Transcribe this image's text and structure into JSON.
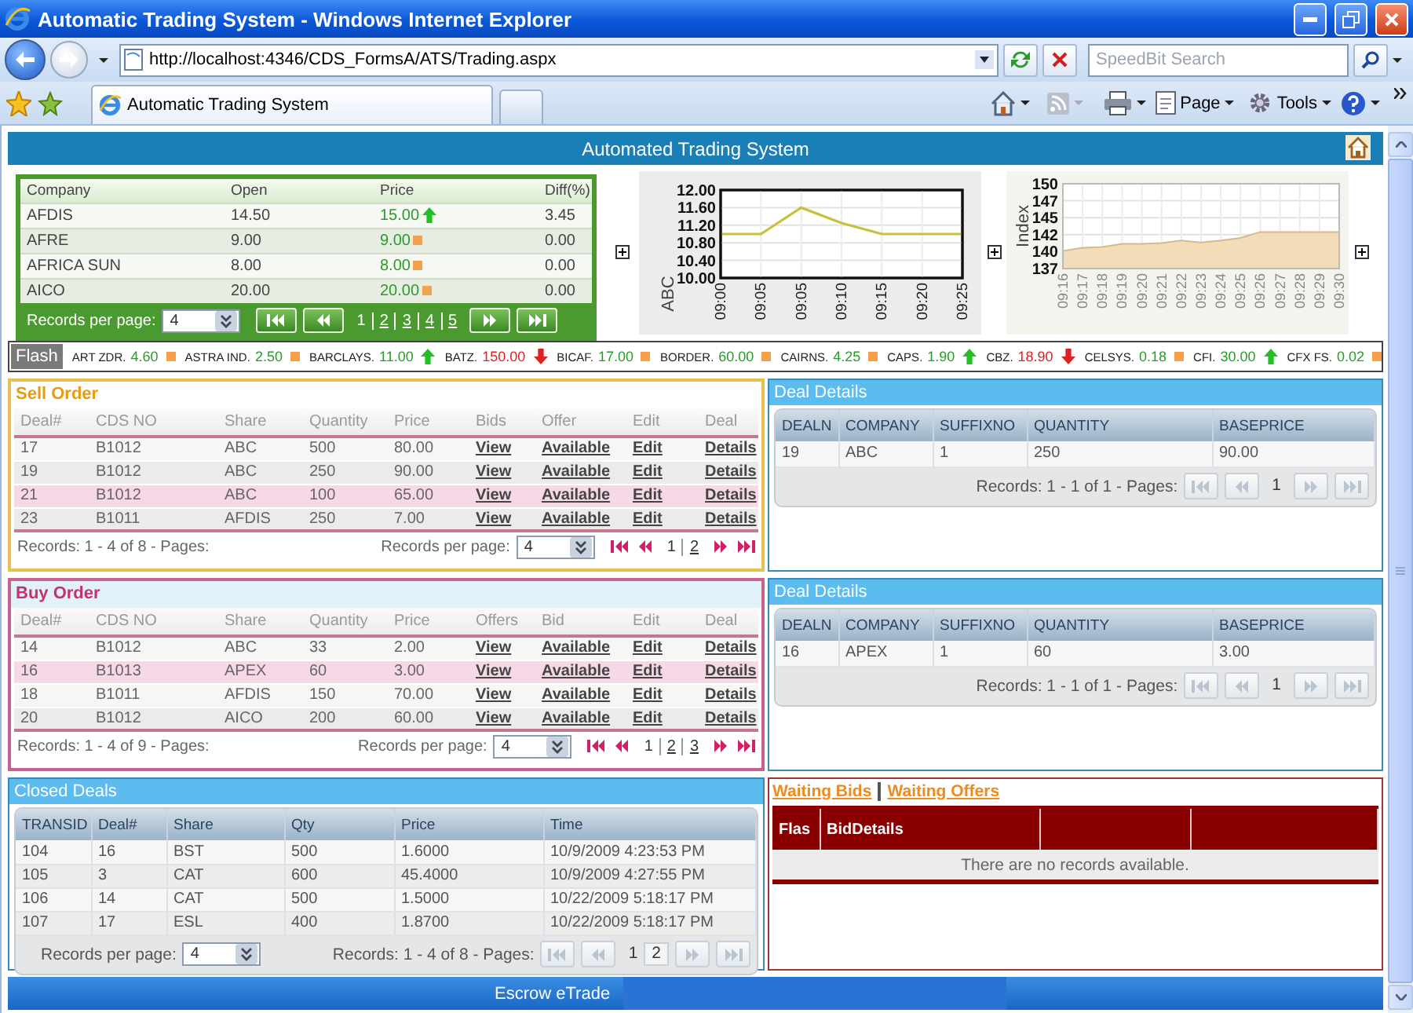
{
  "browser": {
    "title": "Automatic Trading System - Windows Internet Explorer",
    "address": "http://localhost:4346/CDS_FormsA/ATS/Trading.aspx",
    "search_placeholder": "SpeedBit Search",
    "tab": "Automatic Trading System",
    "menus": [
      "Page",
      "Tools"
    ]
  },
  "header": {
    "title": "Automated Trading System"
  },
  "market": {
    "columns": [
      {
        "label": "Company",
        "kind": "text"
      },
      {
        "label": "Open",
        "kind": "text"
      },
      {
        "label": "Price",
        "kind": "trend"
      },
      {
        "label": "Diff(%)",
        "kind": "text"
      }
    ],
    "rows": [
      {
        "cells": [
          "AFDIS",
          "14.50",
          "15.00",
          "3.45"
        ],
        "kind": "up"
      },
      {
        "cells": [
          "AFRE",
          "9.00",
          "9.00",
          "0.00"
        ],
        "kind": "flat"
      },
      {
        "cells": [
          "AFRICA SUN",
          "8.00",
          "8.00",
          "0.00"
        ],
        "kind": "flat"
      },
      {
        "cells": [
          "AICO",
          "20.00",
          "20.00",
          "0.00"
        ],
        "kind": "flat"
      }
    ],
    "pager": {
      "size_label": "Records per page:",
      "page_size": "4",
      "pages": [
        {
          "label": "1",
          "selected": true
        },
        {
          "label": "2",
          "selected": false
        },
        {
          "label": "3",
          "selected": false
        },
        {
          "label": "4",
          "selected": false
        },
        {
          "label": "5",
          "selected": false
        }
      ]
    }
  },
  "charts": [
    {
      "chart_data": {
        "type": "line",
        "ylabel": "ABC",
        "categories": [
          "09:00",
          "09:05",
          "09:05",
          "09:10",
          "09:15",
          "09:20",
          "09:25"
        ],
        "grid": true,
        "series": [
          {
            "color": "#c8c03c",
            "values": [
              11.0,
              11.0,
              11.6,
              11.25,
              11.0,
              11.0,
              11.0
            ]
          }
        ],
        "ylim": [
          10,
          12
        ],
        "yticks": [
          {
            "value": 10,
            "label": "10.00"
          },
          {
            "value": 10.4,
            "label": "10.40"
          },
          {
            "value": 10.8,
            "label": "10.80"
          },
          {
            "value": 11.2,
            "label": "11.20"
          },
          {
            "value": 11.6,
            "label": "11.60"
          },
          {
            "value": 12,
            "label": "12.00"
          }
        ]
      }
    },
    {
      "chart_data": {
        "type": "area",
        "ylabel": "Index",
        "categories": [
          "09:16",
          "09:17",
          "09:18",
          "09:19",
          "09:20",
          "09:21",
          "09:22",
          "09:23",
          "09:24",
          "09:25",
          "09:26",
          "09:27",
          "09:28",
          "09:29",
          "09:30"
        ],
        "grid": true,
        "series": [
          {
            "color": "#f3dcb8",
            "values": [
              139.7,
              140.2,
              140.3,
              140.8,
              140.8,
              140.9,
              141.3,
              141.0,
              141.3,
              141.7,
              142.6,
              142.6,
              142.6,
              142.6,
              142.6
            ]
          }
        ],
        "ylim": [
          137,
          150
        ],
        "yticks": [
          {
            "value": 137,
            "label": "137"
          },
          {
            "value": 139.6,
            "label": "140"
          },
          {
            "value": 142.2,
            "label": "142"
          },
          {
            "value": 144.8,
            "label": "145"
          },
          {
            "value": 147.4,
            "label": "147"
          },
          {
            "value": 150,
            "label": "150"
          }
        ]
      }
    }
  ],
  "flash": {
    "label": "Flash",
    "items": [
      {
        "name": "ART ZDR.",
        "value": "4.60",
        "kind": "flat"
      },
      {
        "name": "ASTRA IND.",
        "value": "2.50",
        "kind": "flat"
      },
      {
        "name": "BARCLAYS.",
        "value": "11.00",
        "kind": "up"
      },
      {
        "name": "BATZ.",
        "value": "150.00",
        "kind": "down"
      },
      {
        "name": "BICAF.",
        "value": "17.00",
        "kind": "flat"
      },
      {
        "name": "BORDER.",
        "value": "60.00",
        "kind": "flat"
      },
      {
        "name": "CAIRNS.",
        "value": "4.25",
        "kind": "flat"
      },
      {
        "name": "CAPS.",
        "value": "1.90",
        "kind": "up"
      },
      {
        "name": "CBZ.",
        "value": "18.90",
        "kind": "down"
      },
      {
        "name": "CELSYS.",
        "value": "0.18",
        "kind": "flat"
      },
      {
        "name": "CFI.",
        "value": "30.00",
        "kind": "up"
      },
      {
        "name": "CFX FS.",
        "value": "0.02",
        "kind": "flat"
      }
    ]
  },
  "sell_order": {
    "title": "Sell Order",
    "columns": [
      {
        "label": "Deal#",
        "kind": "text"
      },
      {
        "label": "CDS NO",
        "kind": "text"
      },
      {
        "label": "Share",
        "kind": "text"
      },
      {
        "label": "Quantity",
        "kind": "text"
      },
      {
        "label": "Price",
        "kind": "text"
      },
      {
        "label": "Bids",
        "kind": "link"
      },
      {
        "label": "Offer",
        "kind": "link"
      },
      {
        "label": "Edit",
        "kind": "link"
      },
      {
        "label": "Deal",
        "kind": "link"
      }
    ],
    "rows": [
      {
        "cells": [
          "17",
          "B1012",
          "ABC",
          "500",
          "80.00",
          "View",
          "Available",
          "Edit",
          "Details"
        ],
        "highlighted": false
      },
      {
        "cells": [
          "19",
          "B1012",
          "ABC",
          "250",
          "90.00",
          "View",
          "Available",
          "Edit",
          "Details"
        ],
        "highlighted": false
      },
      {
        "cells": [
          "21",
          "B1012",
          "ABC",
          "100",
          "65.00",
          "View",
          "Available",
          "Edit",
          "Details"
        ],
        "highlighted": true
      },
      {
        "cells": [
          "23",
          "B1011",
          "AFDIS",
          "250",
          "7.00",
          "View",
          "Available",
          "Edit",
          "Details"
        ],
        "highlighted": false
      }
    ],
    "pager": {
      "summary": "Records: 1 - 4 of 8 - Pages:",
      "size_label": "Records per page:",
      "page_size": "4",
      "pages": [
        {
          "label": "1",
          "selected": true
        },
        {
          "label": "2",
          "selected": false
        }
      ]
    }
  },
  "deal_details": [
    {
      "title": "Deal Details",
      "columns": [
        "DEALN",
        "COMPANY",
        "SUFFIXNO",
        "QUANTITY",
        "BASEPRICE"
      ],
      "rows": [
        [
          "19",
          "ABC",
          "1",
          "250",
          "90.00"
        ]
      ],
      "pager": {
        "summary": "Records: 1 - 1 of 1 - Pages:",
        "pages": [
          {
            "label": "1",
            "selected": true
          }
        ]
      }
    },
    {
      "title": "Deal Details",
      "columns": [
        "DEALN",
        "COMPANY",
        "SUFFIXNO",
        "QUANTITY",
        "BASEPRICE"
      ],
      "rows": [
        [
          "16",
          "APEX",
          "1",
          "60",
          "3.00"
        ]
      ],
      "pager": {
        "summary": "Records: 1 - 1 of 1 - Pages:",
        "pages": [
          {
            "label": "1",
            "selected": true
          }
        ]
      }
    }
  ],
  "buy_order": {
    "title": "Buy Order",
    "columns": [
      {
        "label": "Deal#",
        "kind": "text"
      },
      {
        "label": "CDS NO",
        "kind": "text"
      },
      {
        "label": "Share",
        "kind": "text"
      },
      {
        "label": "Quantity",
        "kind": "text"
      },
      {
        "label": "Price",
        "kind": "text"
      },
      {
        "label": "Offers",
        "kind": "link"
      },
      {
        "label": "Bid",
        "kind": "link"
      },
      {
        "label": "Edit",
        "kind": "link"
      },
      {
        "label": "Deal",
        "kind": "link"
      }
    ],
    "rows": [
      {
        "cells": [
          "14",
          "B1012",
          "ABC",
          "33",
          "2.00",
          "View",
          "Available",
          "Edit",
          "Details"
        ],
        "highlighted": false
      },
      {
        "cells": [
          "16",
          "B1013",
          "APEX",
          "60",
          "3.00",
          "View",
          "Available",
          "Edit",
          "Details"
        ],
        "highlighted": true
      },
      {
        "cells": [
          "18",
          "B1011",
          "AFDIS",
          "150",
          "70.00",
          "View",
          "Available",
          "Edit",
          "Details"
        ],
        "highlighted": false
      },
      {
        "cells": [
          "20",
          "B1012",
          "AICO",
          "200",
          "60.00",
          "View",
          "Available",
          "Edit",
          "Details"
        ],
        "highlighted": false
      }
    ],
    "pager": {
      "summary": "Records: 1 - 4 of 9 - Pages:",
      "size_label": "Records per page:",
      "page_size": "4",
      "pages": [
        {
          "label": "1",
          "selected": true
        },
        {
          "label": "2",
          "selected": false
        },
        {
          "label": "3",
          "selected": false
        }
      ]
    }
  },
  "closed_deals": {
    "title": "Closed Deals",
    "columns": [
      "TRANSID",
      "Deal#",
      "Share",
      "Qty",
      "Price",
      "Time"
    ],
    "rows": [
      [
        "104",
        "16",
        "BST",
        "500",
        "1.6000",
        "10/9/2009 4:23:53 PM"
      ],
      [
        "105",
        "3",
        "CAT",
        "600",
        "45.4000",
        "10/9/2009 4:27:55 PM"
      ],
      [
        "106",
        "14",
        "CAT",
        "500",
        "1.5000",
        "10/22/2009 5:18:17 PM"
      ],
      [
        "107",
        "17",
        "ESL",
        "400",
        "1.8700",
        "10/22/2009 5:18:17 PM"
      ]
    ],
    "pager": {
      "size_label": "Records per page:",
      "page_size": "4",
      "summary": "Records: 1 - 4 of 8 - Pages:",
      "pages": [
        {
          "label": "1",
          "selected": true
        },
        {
          "label": "2",
          "selected": false
        }
      ]
    }
  },
  "waiting": {
    "links": [
      "Waiting Bids",
      "Waiting Offers"
    ],
    "columns": [
      "Flas",
      "BidDetails"
    ],
    "empty_message": "There are no records available."
  },
  "footer": {
    "title": "Escrow eTrade"
  }
}
